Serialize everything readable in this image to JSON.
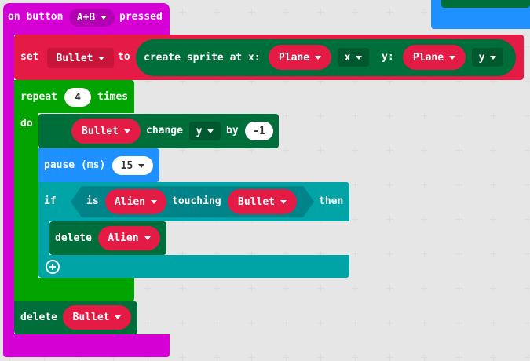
{
  "event": {
    "prefix": "on button",
    "button": "A+B",
    "suffix": "pressed"
  },
  "set_block": {
    "set": "set",
    "var": "Bullet",
    "to": "to",
    "create": "create sprite at x:",
    "x_sprite": "Plane",
    "x_prop": "x",
    "y_label": "y:",
    "y_sprite": "Plane",
    "y_prop": "y"
  },
  "repeat_block": {
    "label": "repeat",
    "count": "4",
    "times": "times",
    "do": "do"
  },
  "change_block": {
    "sprite": "Bullet",
    "change": "change",
    "prop": "y",
    "by": "by",
    "value": "-1"
  },
  "pause_block": {
    "label": "pause (ms)",
    "value": "15"
  },
  "if_block": {
    "if": "if",
    "is": "is",
    "sprite": "Alien",
    "touching": "touching",
    "other": "Bullet",
    "then": "then"
  },
  "delete_alien": {
    "label": "delete",
    "sprite": "Alien"
  },
  "delete_bullet": {
    "label": "delete",
    "sprite": "Bullet"
  },
  "colors": {
    "event": "#d400d4",
    "sprites": "#e31b45",
    "loops": "#00a300",
    "basic": "#1e90ff",
    "logic": "#00a4a6",
    "sprite_ops": "#006e3b"
  }
}
